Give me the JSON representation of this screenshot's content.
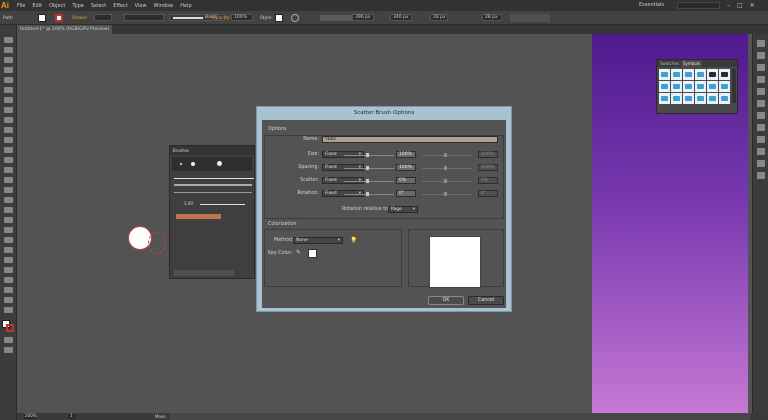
{
  "app": {
    "logo": "Ai",
    "menus": [
      "File",
      "Edit",
      "Object",
      "Type",
      "Select",
      "Effect",
      "View",
      "Window",
      "Help"
    ],
    "workspace": "Essentials"
  },
  "control": {
    "selection": "Path",
    "stroke_label": "Stroke:",
    "brush": "Basic",
    "opacity_label": "Opacity:",
    "opacity": "100%",
    "style_label": "Style:",
    "x": "396 px",
    "y": "340 px",
    "w": "28 px",
    "h": "28 px"
  },
  "doc": {
    "tab": "Untitled-1* @ 200% (RGB/GPU Preview)",
    "zoom": "200%",
    "page": "1",
    "mode": "Move"
  },
  "symbols": {
    "tab1": "Swatches",
    "tab2": "Symbols"
  },
  "brushes": {
    "title": "Brushes",
    "size_label": "3.00"
  },
  "dialog": {
    "title": "Scatter Brush Options",
    "options_label": "Options",
    "name_label": "Name:",
    "name_value": "Ybbz",
    "rows": [
      {
        "label": "Size:",
        "mode": "Fixed",
        "value": "100%",
        "value2": "100%"
      },
      {
        "label": "Spacing:",
        "mode": "Fixed",
        "value": "100%",
        "value2": "100%"
      },
      {
        "label": "Scatter:",
        "mode": "Fixed",
        "value": "0%",
        "value2": "0%"
      },
      {
        "label": "Rotation:",
        "mode": "Fixed",
        "value": "0°",
        "value2": "0°"
      }
    ],
    "rotation_rel_label": "Rotation relative to:",
    "rotation_rel_value": "Page",
    "colorization_label": "Colorization",
    "method_label": "Method:",
    "method_value": "None",
    "key_color_label": "Key Color:",
    "ok": "OK",
    "cancel": "Cancel"
  }
}
